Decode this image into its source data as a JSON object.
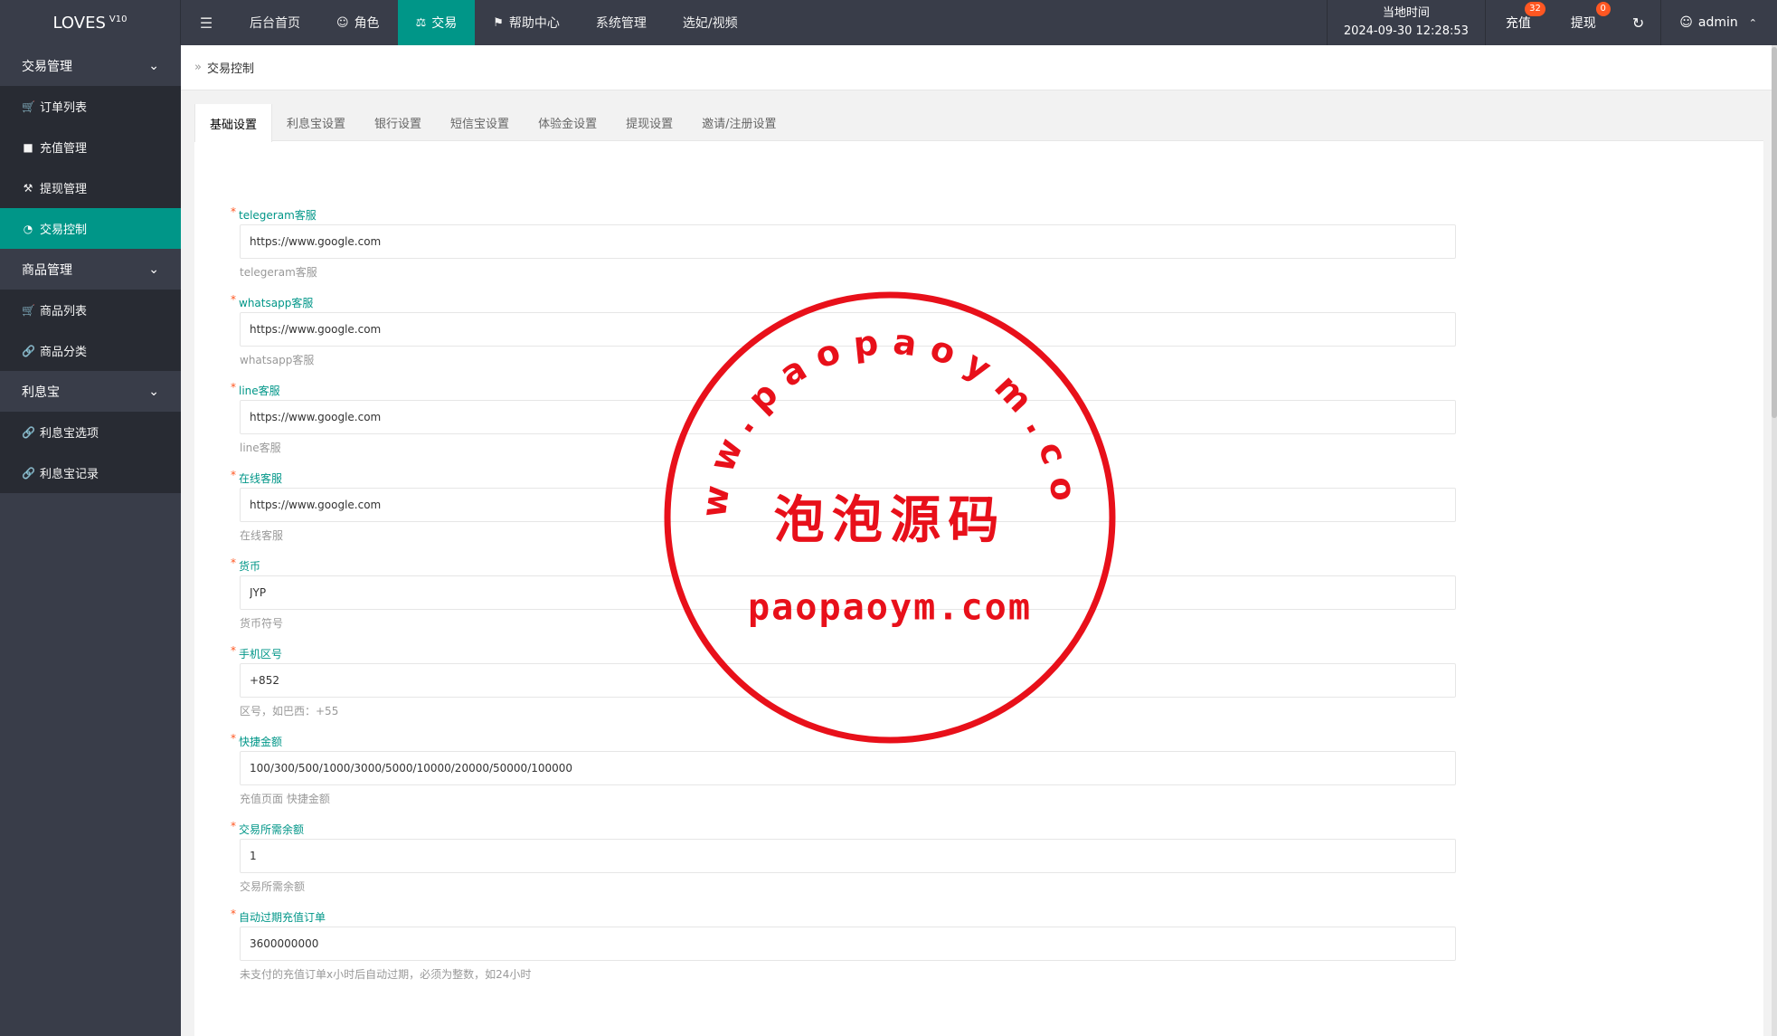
{
  "app": {
    "logo": "LOVES",
    "logo_version": "V10"
  },
  "topnav": {
    "items": [
      {
        "label": "后台首页",
        "icon": ""
      },
      {
        "label": "角色",
        "icon": "user-icon"
      },
      {
        "label": "交易",
        "icon": "scale-icon",
        "active": true
      },
      {
        "label": "帮助中心",
        "icon": "flag-icon"
      },
      {
        "label": "系统管理",
        "icon": ""
      },
      {
        "label": "选妃/视频",
        "icon": ""
      }
    ],
    "clock_label": "当地时间",
    "clock_value": "2024-09-30 12:28:53",
    "recharge_label": "充值",
    "recharge_badge": "32",
    "withdraw_label": "提现",
    "withdraw_badge": "0",
    "user_label": "admin"
  },
  "sidebar": {
    "groups": [
      {
        "label": "交易管理",
        "items": [
          {
            "label": "订单列表",
            "icon": "cart-icon"
          },
          {
            "label": "充值管理",
            "icon": "comment-icon"
          },
          {
            "label": "提现管理",
            "icon": "hammer-icon"
          },
          {
            "label": "交易控制",
            "icon": "dashboard-icon",
            "active": true
          }
        ]
      },
      {
        "label": "商品管理",
        "items": [
          {
            "label": "商品列表",
            "icon": "cart-icon"
          },
          {
            "label": "商品分类",
            "icon": "link-icon"
          }
        ]
      },
      {
        "label": "利息宝",
        "items": [
          {
            "label": "利息宝选项",
            "icon": "link-icon"
          },
          {
            "label": "利息宝记录",
            "icon": "link-icon"
          }
        ]
      }
    ]
  },
  "breadcrumb": {
    "current": "交易控制"
  },
  "tabs": [
    "基础设置",
    "利息宝设置",
    "银行设置",
    "短信宝设置",
    "体验金设置",
    "提现设置",
    "邀请/注册设置"
  ],
  "form": {
    "fields": [
      {
        "label": "telegeram客服",
        "value": "https://www.google.com",
        "help": "telegeram客服"
      },
      {
        "label": "whatsapp客服",
        "value": "https://www.google.com",
        "help": "whatsapp客服"
      },
      {
        "label": "line客服",
        "value": "https://www.google.com",
        "help": "line客服"
      },
      {
        "label": "在线客服",
        "value": "https://www.google.com",
        "help": "在线客服"
      },
      {
        "label": "货币",
        "value": "JYP",
        "help": "货币符号"
      },
      {
        "label": "手机区号",
        "value": "+852",
        "help": "区号，如巴西：+55"
      },
      {
        "label": "快捷金额",
        "value": "100/300/500/1000/3000/5000/10000/20000/50000/100000",
        "help": "充值页面 快捷金额"
      },
      {
        "label": "交易所需余额",
        "value": "1",
        "help": "交易所需余额"
      },
      {
        "label": "自动过期充值订单",
        "value": "3600000000",
        "help": "未支付的充值订单x小时后自动过期，必须为整数，如24小时"
      }
    ]
  },
  "watermark": {
    "ring_text": "www.paopaoym.com",
    "center_text": "泡泡源码",
    "bottom_text": "paopaoym.com",
    "color": "#e8101a"
  },
  "colors": {
    "accent": "#009688",
    "topbar": "#393d49",
    "badge": "#ff5722"
  }
}
